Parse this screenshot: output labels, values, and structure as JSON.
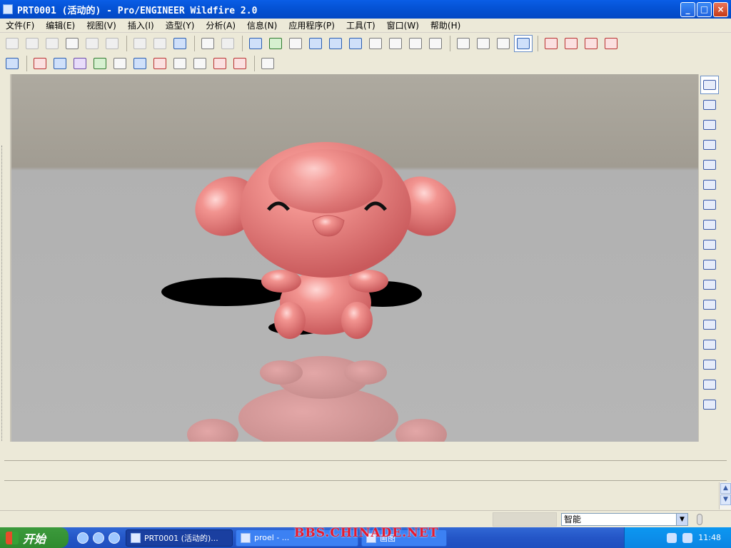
{
  "window": {
    "title": "PRT0001 (活动的) - Pro/ENGINEER Wildfire 2.0",
    "buttons": {
      "minimize": "_",
      "maximize": "□",
      "close": "×"
    }
  },
  "menubar": {
    "items": [
      "文件(F)",
      "编辑(E)",
      "视图(V)",
      "插入(I)",
      "造型(Y)",
      "分析(A)",
      "信息(N)",
      "应用程序(P)",
      "工具(T)",
      "窗口(W)",
      "帮助(H)"
    ]
  },
  "toolbar1": {
    "icons": [
      "new-icon",
      "open-icon",
      "save-icon",
      "print-icon",
      "send-mail-icon",
      "copy-disabled-icon",
      "undo-icon",
      "redo-icon",
      "regenerate-icon",
      "find-icon",
      "select-box-icon",
      "repaint-icon",
      "spin-center-icon",
      "orient-mode-icon",
      "zoom-in-icon",
      "zoom-out-icon",
      "refit-icon",
      "reorient-icon",
      "saved-views-icon",
      "layers-icon",
      "view-manager-icon",
      "wireframe-icon",
      "hidden-line-icon",
      "no-hidden-icon",
      "shading-icon",
      "datum-planes-icon",
      "datum-axes-icon",
      "datum-points-icon",
      "coordinate-systems-icon"
    ]
  },
  "toolbar2": {
    "icons": [
      "grid-icon",
      "curve-analysis-icon",
      "surface-analysis-icon",
      "curvature-icon",
      "color-map-icon",
      "shading-analysis-icon",
      "draft-icon",
      "slope-icon",
      "deviation-icon",
      "offset-icon",
      "delete-analysis-icon",
      "delete-all-icon",
      "whats-this-icon"
    ]
  },
  "right_toolbar": {
    "icons": [
      "select-arrow-icon",
      "style-plane-icon",
      "curve-icon",
      "curve-edit-icon",
      "surface-icon",
      "surface-edit-icon",
      "surface-connect-icon",
      "trim-icon",
      "done-check-icon",
      "sketch-icon",
      "plane-icon",
      "axis-icon",
      "datum-curve-icon",
      "datum-point-icon",
      "csys-icon",
      "analysis-feature-icon",
      "ref-chain-icon"
    ]
  },
  "statusbar": {
    "filter_value": "智能"
  },
  "taskbar": {
    "start_label": "开始",
    "tasks": [
      {
        "label": "PRT0001 (活动的)...",
        "active": true
      },
      {
        "label": "proel - ...",
        "active": false
      },
      {
        "label": "画图",
        "active": false
      }
    ],
    "clock": "11:48"
  },
  "watermark": "BBS.CHINADE.NET",
  "colors": {
    "model_pink": "#e8787a",
    "titlebar_blue": "#0553d6"
  }
}
